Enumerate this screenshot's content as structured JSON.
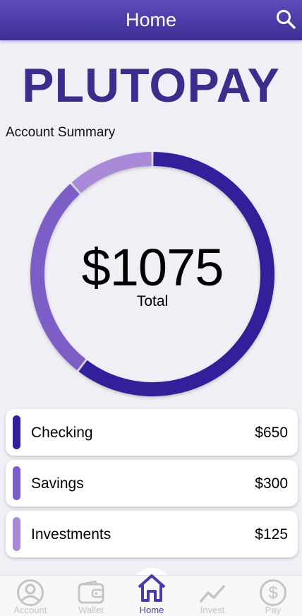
{
  "header": {
    "title": "Home",
    "search_icon": "search-icon"
  },
  "brand": {
    "name": "PLUTOPAY",
    "color": "#3a2d8c"
  },
  "summary": {
    "title": "Account Summary",
    "total_amount": "$1075",
    "total_label": "Total"
  },
  "chart_data": {
    "type": "pie",
    "categories": [
      "Checking",
      "Savings",
      "Investments"
    ],
    "values": [
      650,
      300,
      125
    ],
    "colors": [
      "#32209a",
      "#7d5dc6",
      "#a88ad9"
    ],
    "title": "",
    "center_text": "$1075"
  },
  "accounts": [
    {
      "name": "Checking",
      "amount": "$650",
      "color": "#32209a"
    },
    {
      "name": "Savings",
      "amount": "$300",
      "color": "#7d5dc6"
    },
    {
      "name": "Investments",
      "amount": "$125",
      "color": "#a88ad9"
    }
  ],
  "nav": {
    "items": [
      {
        "label": "Account",
        "icon": "account-icon",
        "active": false
      },
      {
        "label": "Wallet",
        "icon": "wallet-icon",
        "active": false
      },
      {
        "label": "Home",
        "icon": "home-icon",
        "active": true
      },
      {
        "label": "Invest",
        "icon": "invest-icon",
        "active": false
      },
      {
        "label": "Pay",
        "icon": "pay-icon",
        "active": false
      }
    ],
    "active_color": "#4a3aa8",
    "inactive_color": "#c4c4c4"
  }
}
